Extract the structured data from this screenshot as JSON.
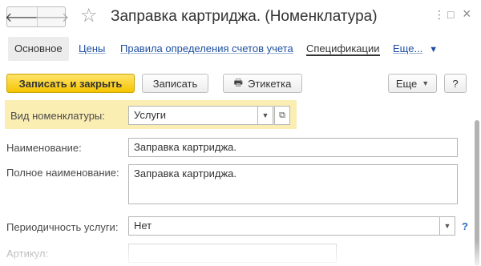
{
  "window": {
    "title": "Заправка картриджа. (Номенклатура)",
    "nav_back_glyph": "🡐",
    "nav_forward_glyph": "🡒",
    "star_glyph": "☆",
    "menu_glyph": "⋮",
    "expand_glyph": "□",
    "close_glyph": "×"
  },
  "tabs": [
    {
      "label": "Основное"
    },
    {
      "label": "Цены"
    },
    {
      "label": "Правила определения счетов учета"
    },
    {
      "label": "Спецификации"
    },
    {
      "label": "Еще..."
    }
  ],
  "toolbar": {
    "save_close_label": "Записать и закрыть",
    "save_label": "Записать",
    "label_button": "Этикетка",
    "more_label": "Еще",
    "help_label": "?"
  },
  "form": {
    "item_type_label": "Вид номенклатуры:",
    "item_type_value": "Услуги",
    "name_label": "Наименование:",
    "name_value": "Заправка картриджа.",
    "full_name_label": "Полное наименование:",
    "full_name_value": "Заправка картриджа.",
    "periodicity_label": "Периодичность услуги:",
    "periodicity_value": "Нет",
    "periodicity_help": "?",
    "sku_label": "Артикул:",
    "sku_value": ""
  },
  "colors": {
    "primary_button": "#f5c400",
    "highlight_row": "#fbeeb3",
    "link": "#1f4fa0"
  }
}
